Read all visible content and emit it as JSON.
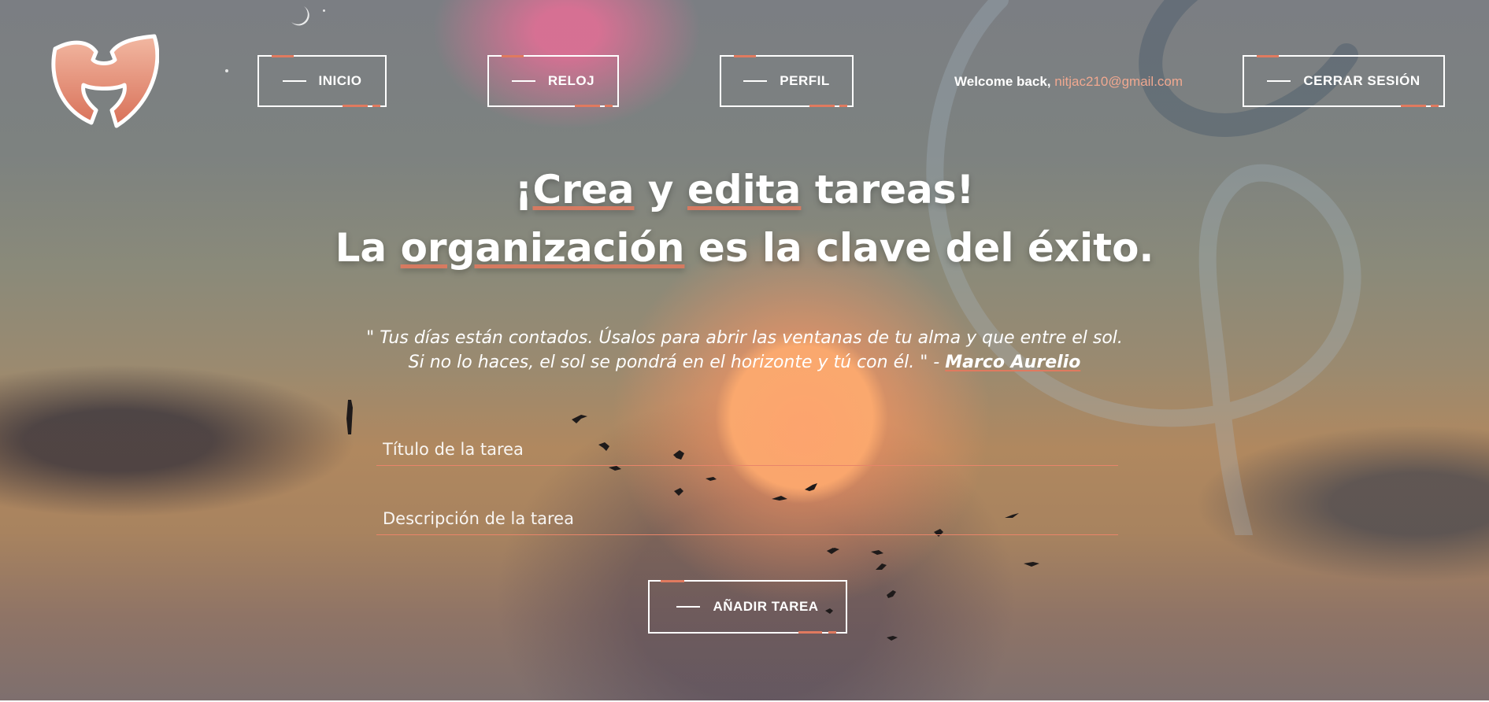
{
  "nav": {
    "inicio_label": "INICIO",
    "reloj_label": "RELOJ",
    "perfil_label": "PERFIL",
    "welcome_text": "Welcome back,",
    "user_email": "nitjac210@gmail.com",
    "logout_label": "CERRAR SESIÓN"
  },
  "headline": {
    "line1_a": "¡",
    "line1_crea": "Crea",
    "line1_b": " y ",
    "line1_edita": "edita",
    "line1_c": " tareas!",
    "line2_a": "La ",
    "line2_organizacion": "organización",
    "line2_b": " es la clave del éxito."
  },
  "quote": {
    "line1": "\" Tus días están contados. Úsalos para abrir las ventanas de tu alma y que entre el sol.",
    "line2": "Si no lo haces, el sol se pondrá en el horizonte y tú con él. \" - ",
    "author": "Marco Aurelio"
  },
  "form": {
    "title_placeholder": "Título de la tarea",
    "description_placeholder": "Descripción de la tarea",
    "submit_label": "AÑADIR TAREA"
  },
  "colors": {
    "accent": "#e07a5f",
    "email": "#f0a890"
  },
  "icons": {
    "logo": "wu-tang-logo-icon"
  }
}
